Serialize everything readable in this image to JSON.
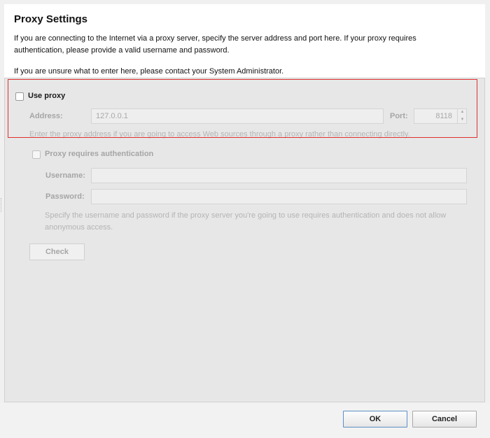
{
  "title": "Proxy Settings",
  "intro": "If you are connecting to the Internet via a proxy server, specify the server address and port here. If your proxy requires authentication, please provide a valid username and password.",
  "note": "If you are unsure what to enter here, please contact your System Administrator.",
  "use_proxy": {
    "label": "Use proxy",
    "checked": false
  },
  "address": {
    "label": "Address:",
    "value": "127.0.0.1"
  },
  "port": {
    "label": "Port:",
    "value": "8118"
  },
  "proxy_hint": "Enter the proxy address if you are going to access Web sources through a proxy rather than connecting directly.",
  "auth": {
    "label": "Proxy requires authentication",
    "checked": false
  },
  "username": {
    "label": "Username:",
    "value": ""
  },
  "password": {
    "label": "Password:",
    "value": ""
  },
  "auth_hint": "Specify the username and password if the proxy server you're going to use requires authentication and does not allow anonymous access.",
  "buttons": {
    "check": "Check",
    "ok": "OK",
    "cancel": "Cancel"
  },
  "icons": {
    "spin_up": "spin-up-arrow",
    "spin_down": "spin-down-arrow"
  },
  "colors": {
    "highlight": "#e03030",
    "ok_border": "#5b8ec5"
  }
}
